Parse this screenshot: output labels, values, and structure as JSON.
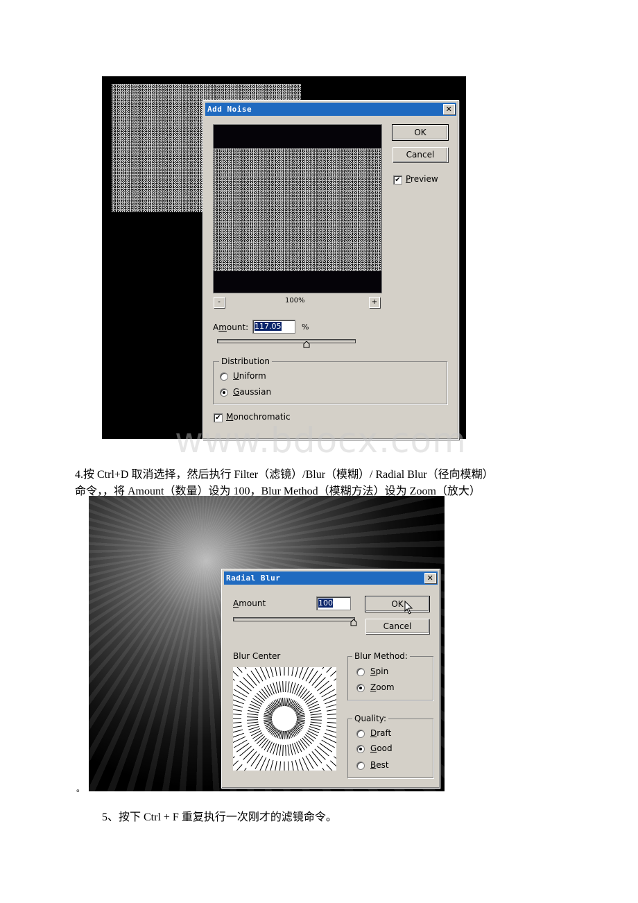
{
  "watermark": "www.bdocx.com",
  "add_noise_dialog": {
    "title": "Add Noise",
    "close_icon": "close-icon",
    "ok_label": "OK",
    "cancel_label": "Cancel",
    "preview_label": "Preview",
    "preview_checked": true,
    "zoom_level": "100%",
    "zoom_out_label": "-",
    "zoom_in_label": "+",
    "amount_label": "Amount:",
    "amount_value": "117.05",
    "amount_unit": "%",
    "amount_slider_fraction": 0.65,
    "distribution_legend": "Distribution",
    "distribution_options": [
      {
        "label": "Uniform",
        "selected": false
      },
      {
        "label": "Gaussian",
        "selected": true
      }
    ],
    "monochromatic_label": "Monochromatic",
    "monochromatic_checked": true
  },
  "step4_text": {
    "line1": "4.按 Ctrl+D 取消选择，然后执行 Filter（滤镜）/Blur（模糊）/ Radial Blur（径向模糊）",
    "line2": "命令，，将 Amount（数量）设为 100，Blur Method（模糊方法）设为 Zoom（放大）"
  },
  "radial_blur_dialog": {
    "title": "Radial Blur",
    "close_icon": "close-icon",
    "amount_label": "Amount",
    "amount_value": "100",
    "amount_slider_fraction": 1.0,
    "ok_label": "OK",
    "cancel_label": "Cancel",
    "blur_center_label": "Blur Center",
    "blur_method_legend": "Blur Method:",
    "blur_method_options": [
      {
        "label": "Spin",
        "selected": false
      },
      {
        "label": "Zoom",
        "selected": true
      }
    ],
    "quality_legend": "Quality:",
    "quality_options": [
      {
        "label": "Draft",
        "selected": false
      },
      {
        "label": "Good",
        "selected": true
      },
      {
        "label": "Best",
        "selected": false
      }
    ]
  },
  "trailing_mark": "。",
  "step5_text": "5、按下 Ctrl + F 重复执行一次刚才的滤镜命令。"
}
